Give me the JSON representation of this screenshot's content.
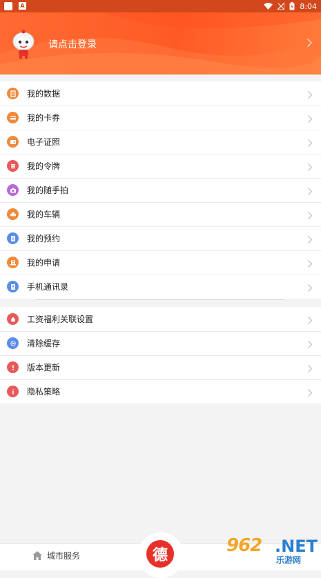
{
  "status_bar": {
    "time": "8:04"
  },
  "header": {
    "login_text": "请点击登录"
  },
  "menu_group1": [
    {
      "label": "我的数据",
      "icon": "data-icon",
      "color": "#f08a3c"
    },
    {
      "label": "我的卡券",
      "icon": "coupon-icon",
      "color": "#f08a3c"
    },
    {
      "label": "电子证照",
      "icon": "wallet-icon",
      "color": "#f08a3c"
    },
    {
      "label": "我的令牌",
      "icon": "token-icon",
      "color": "#e85a5a"
    },
    {
      "label": "我的随手拍",
      "icon": "camera-icon",
      "color": "#b66bd8"
    },
    {
      "label": "我的车辆",
      "icon": "car-icon",
      "color": "#f08a3c"
    },
    {
      "label": "我的预约",
      "icon": "appointment-icon",
      "color": "#5b8de8"
    },
    {
      "label": "我的申请",
      "icon": "application-icon",
      "color": "#f08a3c"
    },
    {
      "label": "手机通讯录",
      "icon": "contacts-icon",
      "color": "#5b8de8"
    }
  ],
  "menu_group2": [
    {
      "label": "工资福利关联设置",
      "icon": "salary-icon",
      "color": "#e85a5a"
    },
    {
      "label": "清除缓存",
      "icon": "gear-icon",
      "color": "#5b8de8"
    },
    {
      "label": "版本更新",
      "icon": "alert-icon",
      "color": "#e85a5a"
    },
    {
      "label": "隐私策略",
      "icon": "info-icon",
      "color": "#e85a5a"
    }
  ],
  "tab_bar": {
    "home_label": "城市服务",
    "center_char": "德"
  },
  "watermark": {
    "number": "962",
    "domain": ".NET",
    "sub": "乐游网"
  }
}
